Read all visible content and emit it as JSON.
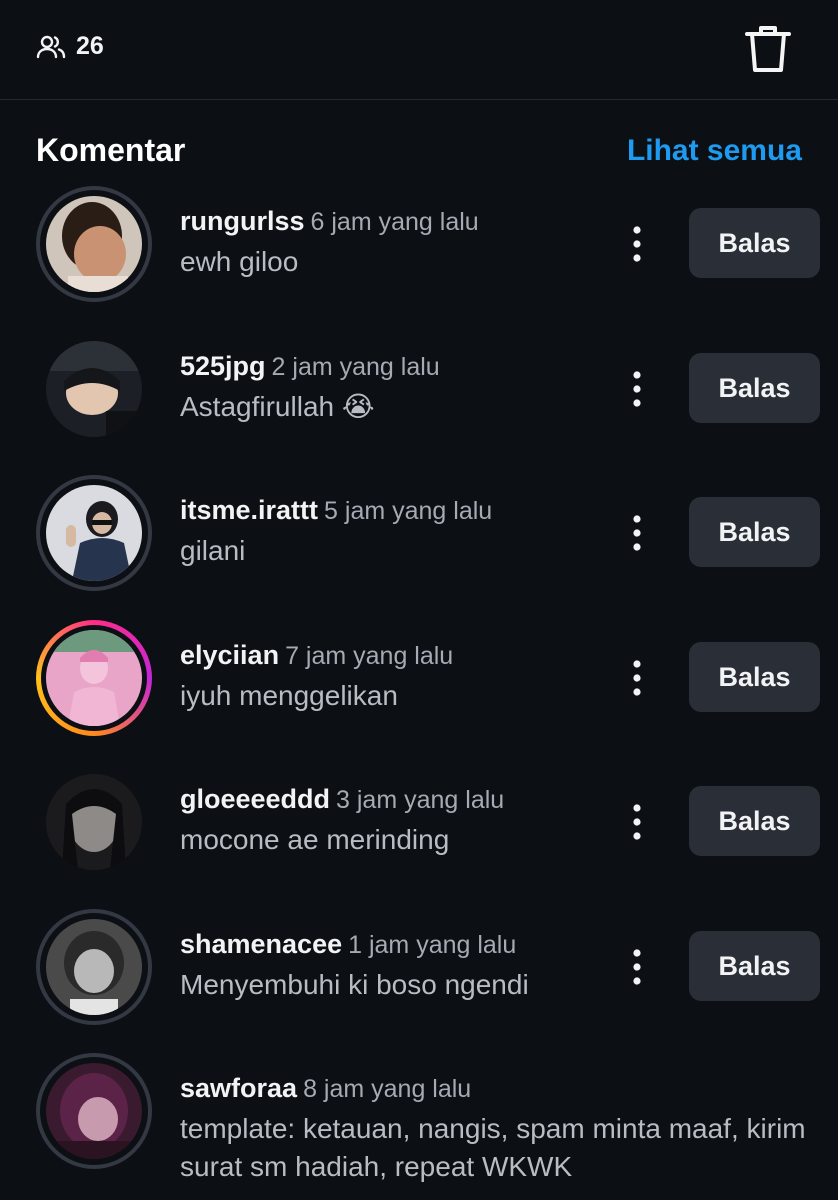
{
  "header": {
    "viewer_icon": "people-icon",
    "viewer_count": "26",
    "delete_icon": "trash-icon"
  },
  "section": {
    "title": "Komentar",
    "see_all_label": "Lihat semua"
  },
  "comments": [
    {
      "username": "rungurlss",
      "time": "6 jam yang lalu",
      "text": "ewh giloo",
      "reply_label": "Balas"
    },
    {
      "username": "525jpg",
      "time": "2 jam yang lalu",
      "text": "Astagfirullah 😭",
      "reply_label": "Balas"
    },
    {
      "username": "itsme.irattt",
      "time": "5 jam yang lalu",
      "text": "gilani",
      "reply_label": "Balas"
    },
    {
      "username": "elyciian",
      "time": "7 jam yang lalu",
      "text": "iyuh menggelikan",
      "reply_label": "Balas"
    },
    {
      "username": "gloeeeeddd",
      "time": "3 jam yang lalu",
      "text": "mocone ae merinding",
      "reply_label": "Balas"
    },
    {
      "username": "shamenacee",
      "time": "1 jam yang lalu",
      "text": "Menyembuhi ki boso ngendi",
      "reply_label": "Balas"
    },
    {
      "username": "sawforaa",
      "time": "8 jam yang lalu",
      "text": "template: ketauan, nangis, spam minta maaf, kirim surat sm hadiah, repeat WKWK"
    }
  ],
  "colors": {
    "background": "#0c0f14",
    "accent": "#1d9bf0",
    "button_bg": "#2a2e36",
    "secondary_text": "#a6aab2"
  }
}
